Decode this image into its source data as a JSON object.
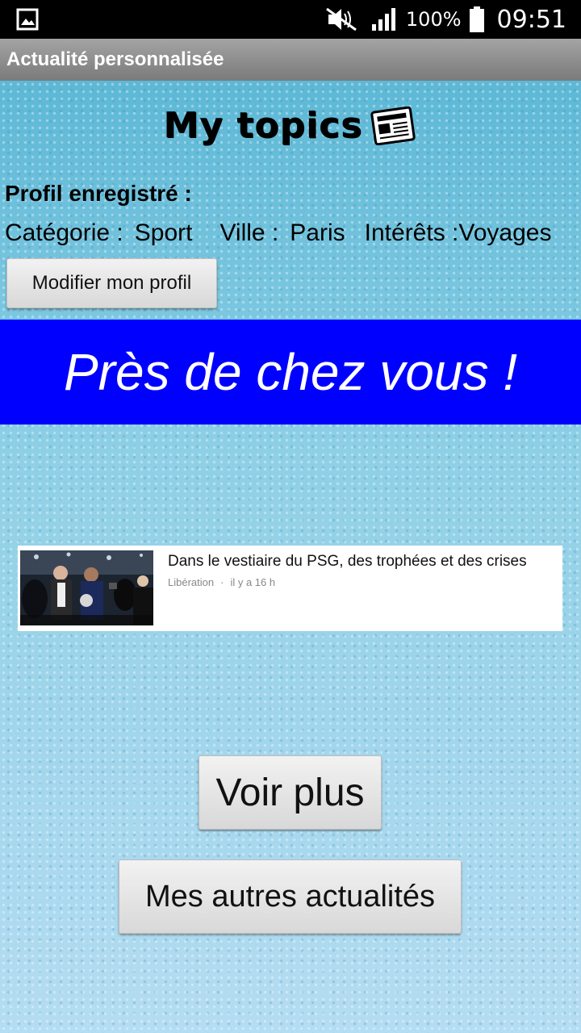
{
  "status_bar": {
    "battery": "100%",
    "time": "09:51",
    "icons": [
      "gallery-icon",
      "mute-icon",
      "signal-icon",
      "battery-icon"
    ]
  },
  "app_bar": {
    "title": "Actualité personnalisée"
  },
  "logo": {
    "text": "My topics",
    "icon": "newspaper-icon"
  },
  "profile": {
    "heading": "Profil enregistré :",
    "category_label": "Catégorie :",
    "category_value": "Sport",
    "city_label": "Ville :",
    "city_value": "Paris",
    "interests_label": "Intérêts :",
    "interests_value": "Voyages",
    "edit_button": "Modifier mon profil"
  },
  "banner": {
    "text": "Près de chez vous !"
  },
  "news": [
    {
      "title": "Dans le vestiaire du PSG, des trophées et des crises",
      "source": "Libération",
      "time": "il y a 16 h"
    }
  ],
  "actions": {
    "more": "Voir plus",
    "other": "Mes autres actualités"
  },
  "colors": {
    "banner": "#0000ff",
    "app_bar": "#8f8f8f",
    "background": "#7ec8e0"
  }
}
